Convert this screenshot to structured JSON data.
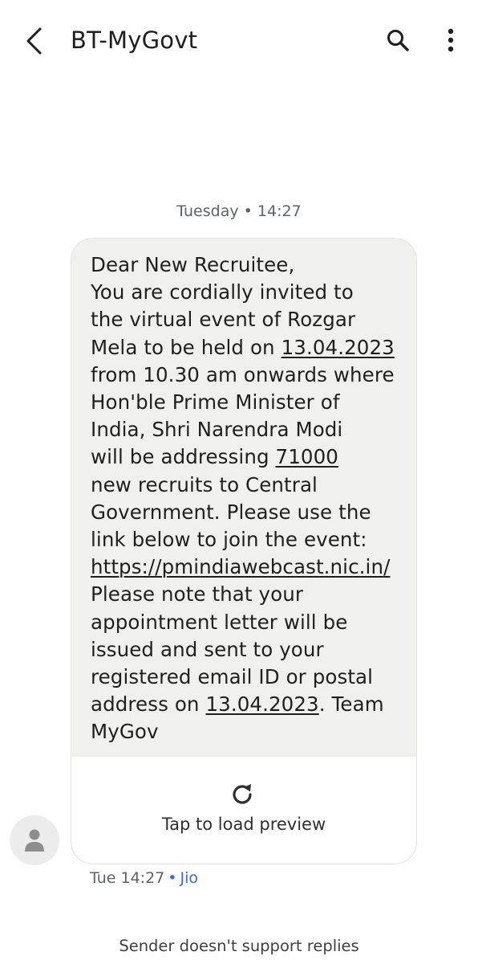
{
  "header": {
    "title": "BT-MyGovt",
    "back_icon": "back-arrow-icon",
    "search_icon": "search-icon",
    "more_icon": "more-vert-icon"
  },
  "date_separator": {
    "day": "Tuesday",
    "bullet": "•",
    "time": "14:27"
  },
  "message": {
    "segments": [
      {
        "text": "Dear New Recruitee,\nYou are cordially invited to\nthe virtual event of Rozgar\nMela to be held on ",
        "link": false
      },
      {
        "text": "13.04.2023",
        "link": true
      },
      {
        "text": "\nfrom 10.30 am onwards where\nHon'ble Prime Minister of\nIndia, Shri Narendra Modi\nwill be addressing ",
        "link": false
      },
      {
        "text": "71000",
        "link": true
      },
      {
        "text": "\nnew recruits to Central\nGovernment. Please use the\nlink below to join the event:\n",
        "link": false
      },
      {
        "text": "https://pmindiawebcast.nic.in/",
        "link": true
      },
      {
        "text": "\nPlease note that your\nappointment letter will be\nissued and sent to your\nregistered email ID or postal\naddress on ",
        "link": false
      },
      {
        "text": "13.04.2023",
        "link": true
      },
      {
        "text": ". Team\nMyGov",
        "link": false
      }
    ],
    "preview_label": "Tap to load preview",
    "preview_icon": "refresh-icon"
  },
  "meta": {
    "time": "Tue 14:27",
    "bullet": "•",
    "carrier": "Jio"
  },
  "avatar": {
    "icon": "person-icon"
  },
  "footer": {
    "text": "Sender doesn't support replies"
  },
  "colors": {
    "bubble_bg": "#f0f0ee",
    "carrier_accent": "#3c6bd6",
    "avatar_bg": "#ececec"
  }
}
